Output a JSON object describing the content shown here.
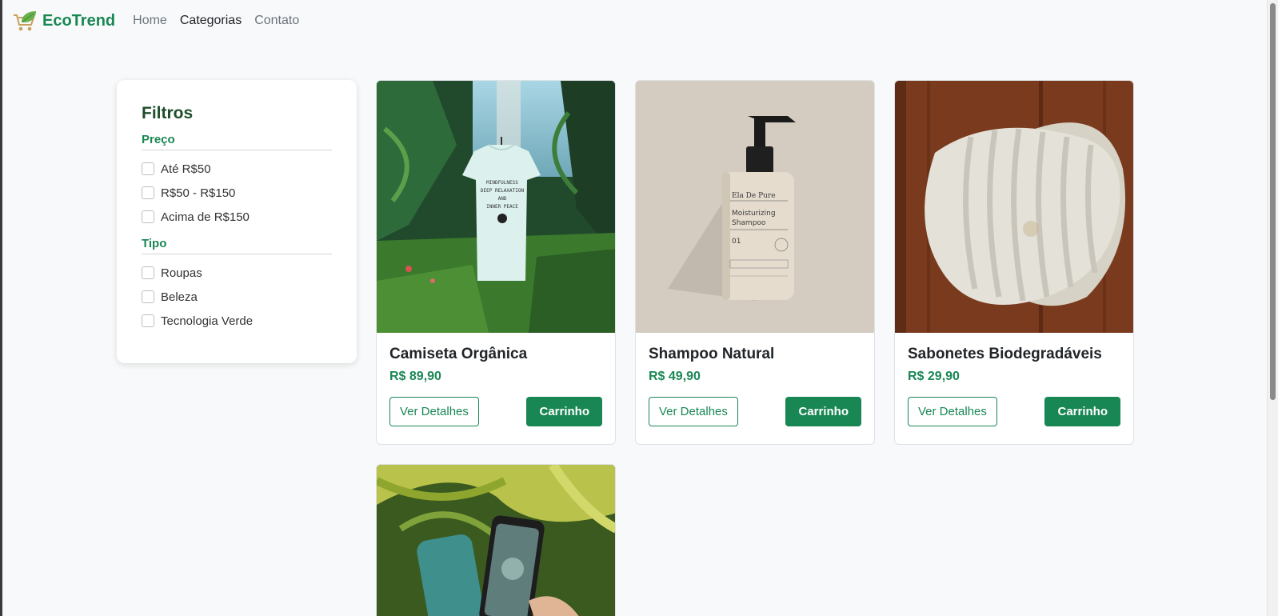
{
  "navbar": {
    "brand": "EcoTrend",
    "links": [
      {
        "label": "Home"
      },
      {
        "label": "Categorias"
      },
      {
        "label": "Contato"
      }
    ]
  },
  "filters": {
    "title": "Filtros",
    "groups": [
      {
        "title": "Preço",
        "options": [
          "Até R$50",
          "R$50 - R$150",
          "Acima de R$150"
        ]
      },
      {
        "title": "Tipo",
        "options": [
          "Roupas",
          "Beleza",
          "Tecnologia Verde"
        ]
      }
    ]
  },
  "products": [
    {
      "name": "Camiseta Orgânica",
      "price": "R$ 89,90",
      "details_label": "Ver Detalhes",
      "cart_label": "Carrinho"
    },
    {
      "name": "Shampoo Natural",
      "price": "R$ 49,90",
      "details_label": "Ver Detalhes",
      "cart_label": "Carrinho"
    },
    {
      "name": "Sabonetes Biodegradáveis",
      "price": "R$ 29,90",
      "details_label": "Ver Detalhes",
      "cart_label": "Carrinho"
    }
  ],
  "shirt_print": [
    "MINDFULNESS",
    "DEEP RELAXATION",
    "AND",
    "INNER PEACE"
  ],
  "bottle_label": {
    "brand": "Ela De Pure",
    "line1": "Moisturizing",
    "line2": "Shampoo",
    "number": "01"
  },
  "colors": {
    "accent": "#198754",
    "heading": "#1e4d2b",
    "background": "#f8f9fa"
  }
}
